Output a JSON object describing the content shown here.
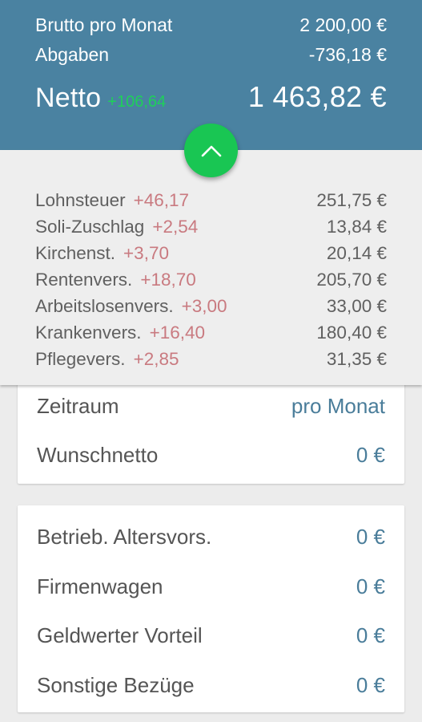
{
  "header": {
    "gross_label": "Brutto pro Monat",
    "gross_value": "2 200,00 €",
    "deductions_label": "Abgaben",
    "deductions_value": "-736,18 €",
    "net_label": "Netto",
    "net_delta": "+106,64",
    "net_value": "1 463,82 €"
  },
  "fab": {
    "icon": "chevron-up-icon"
  },
  "breakdown": [
    {
      "label": "Lohnsteuer",
      "delta": "+46,17",
      "value": "251,75 €"
    },
    {
      "label": "Soli-Zuschlag",
      "delta": "+2,54",
      "value": "13,84 €"
    },
    {
      "label": "Kirchenst.",
      "delta": "+3,70",
      "value": "20,14 €"
    },
    {
      "label": "Rentenvers.",
      "delta": "+18,70",
      "value": "205,70 €"
    },
    {
      "label": "Arbeitslosenvers.",
      "delta": "+3,00",
      "value": "33,00 €"
    },
    {
      "label": "Krankenvers.",
      "delta": "+16,40",
      "value": "180,40 €"
    },
    {
      "label": "Pflegevers.",
      "delta": "+2,85",
      "value": "31,35 €"
    }
  ],
  "settings": {
    "period_label": "Zeitraum",
    "period_value": "pro Monat",
    "desired_net_label": "Wunschnetto",
    "desired_net_value": "0 €"
  },
  "extras": [
    {
      "label": "Betrieb. Altersvors.",
      "value": "0 €"
    },
    {
      "label": "Firmenwagen",
      "value": "0 €"
    },
    {
      "label": "Geldwerter Vorteil",
      "value": "0 €"
    },
    {
      "label": "Sonstige Bezüge",
      "value": "0 €"
    }
  ],
  "colors": {
    "header_bg": "#4a82a1",
    "accent_green": "#19c653",
    "delta_red": "#c97a80",
    "value_blue": "#4a7d9a"
  }
}
